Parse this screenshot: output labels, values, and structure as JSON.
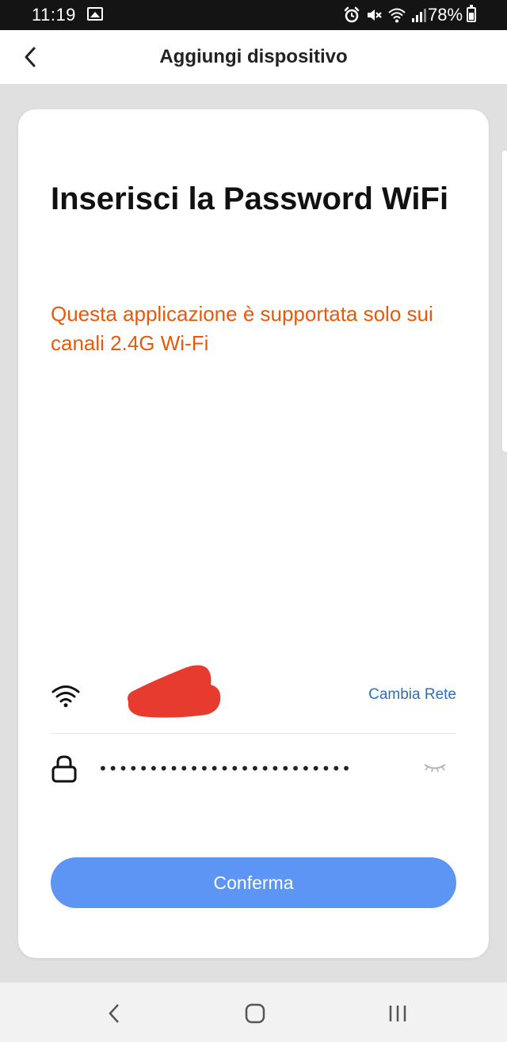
{
  "status_bar": {
    "time": "11:19",
    "battery": "78%",
    "icons": [
      "image-icon",
      "alarm-icon",
      "mute-icon",
      "wifi-icon",
      "signal-icon",
      "battery-icon"
    ]
  },
  "app_bar": {
    "title": "Aggiungi dispositivo",
    "back_icon": "chevron-left-icon"
  },
  "content": {
    "heading": "Inserisci la Password WiFi",
    "warning": "Questa applicazione è supportata solo sui canali 2.4G Wi-Fi",
    "network": {
      "icon": "wifi-icon",
      "name_redacted": true,
      "change_label": "Cambia Rete"
    },
    "password": {
      "icon": "lock-icon",
      "value": "•••••••••••••••••••••••••",
      "visibility_icon": "eye-closed-icon"
    },
    "confirm_label": "Conferma"
  },
  "colors": {
    "accent": "#5d95f5",
    "warning": "#e8590c",
    "link": "#2e6fb8",
    "background": "#e0e0e0",
    "redaction": "#e63b2e"
  },
  "nav_bar": {
    "buttons": [
      "back-icon",
      "home-icon",
      "recents-icon"
    ]
  }
}
